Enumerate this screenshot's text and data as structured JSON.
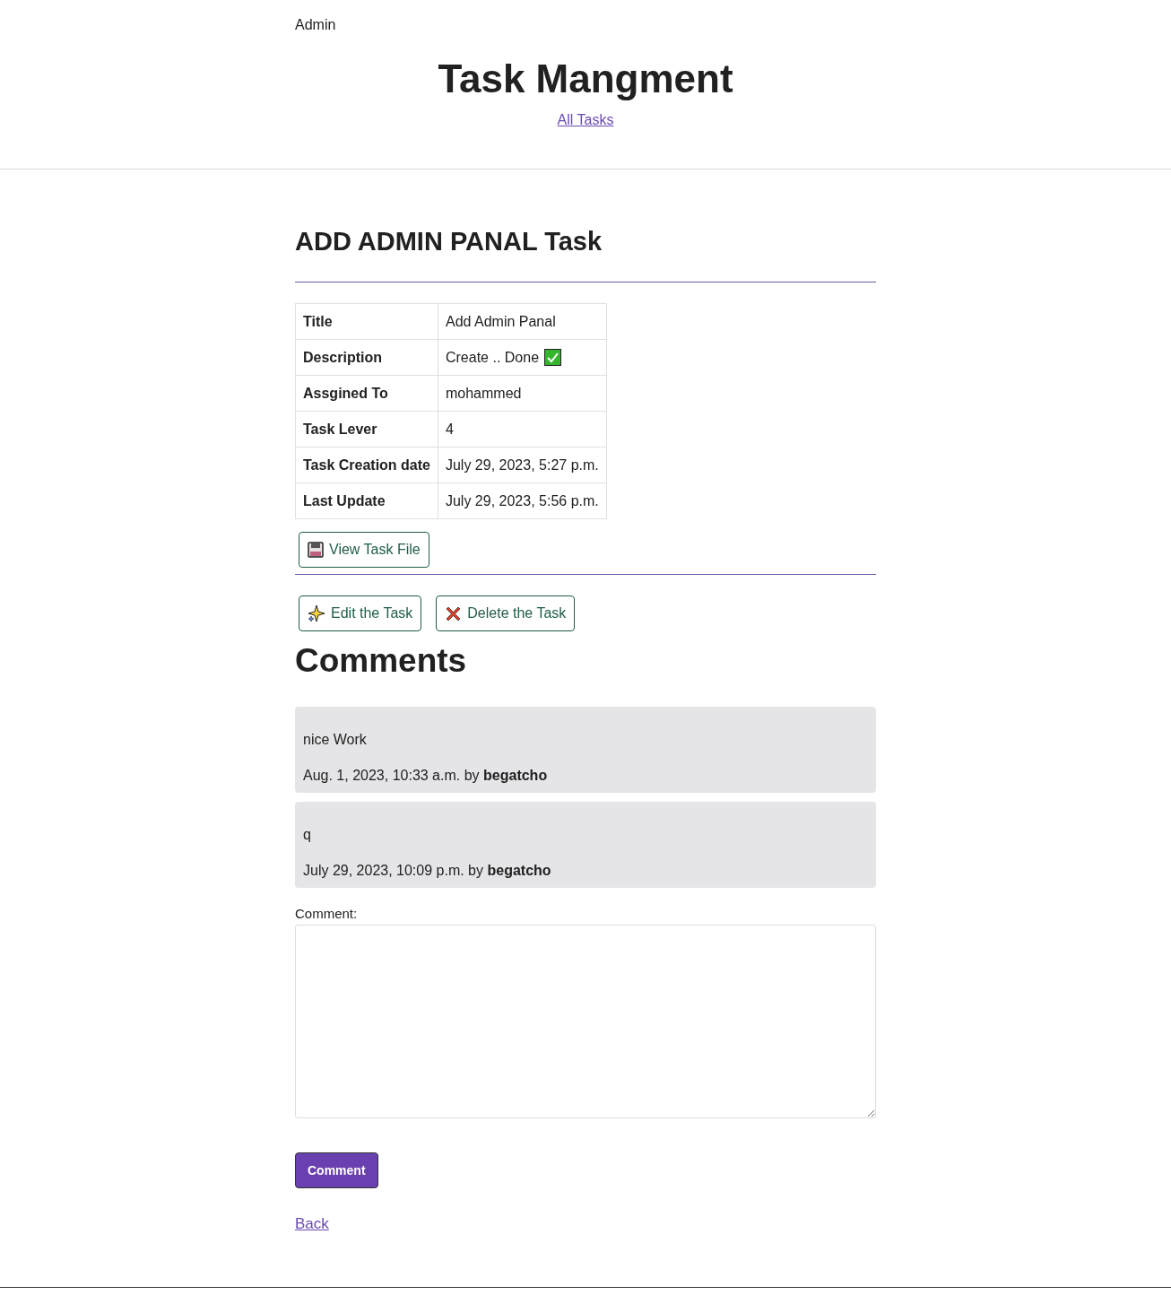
{
  "header": {
    "user": "Admin",
    "title": "Task Mangment",
    "nav_link": "All Tasks"
  },
  "task": {
    "heading": "ADD ADMIN PANAL Task",
    "rows": [
      {
        "label": "Title",
        "value": "Add Admin Panal",
        "kind": "text"
      },
      {
        "label": "Description",
        "value": "Create .. Done",
        "kind": "done"
      },
      {
        "label": "Assgined To",
        "value": "mohammed",
        "kind": "text"
      },
      {
        "label": "Task Lever",
        "value": "4",
        "kind": "text"
      },
      {
        "label": "Task Creation date",
        "value": "July 29, 2023, 5:27 p.m.",
        "kind": "text"
      },
      {
        "label": "Last Update",
        "value": "July 29, 2023, 5:56 p.m.",
        "kind": "text"
      }
    ],
    "file_button": {
      "label": "View Task File",
      "kind": "file"
    },
    "actions": [
      {
        "label": "Edit the Task",
        "kind": "edit"
      },
      {
        "label": "Delete the Task",
        "kind": "delete"
      }
    ]
  },
  "comments": {
    "heading": "Comments",
    "items": [
      {
        "text": "nice Work",
        "meta": "Aug. 1, 2023, 10:33 a.m. by **begatcho**"
      },
      {
        "text": "q",
        "meta": "July 29, 2023, 10:09 p.m. by **begatcho**"
      }
    ],
    "form_label": "Comment:",
    "submit": "Comment"
  },
  "back_link": "Back"
}
